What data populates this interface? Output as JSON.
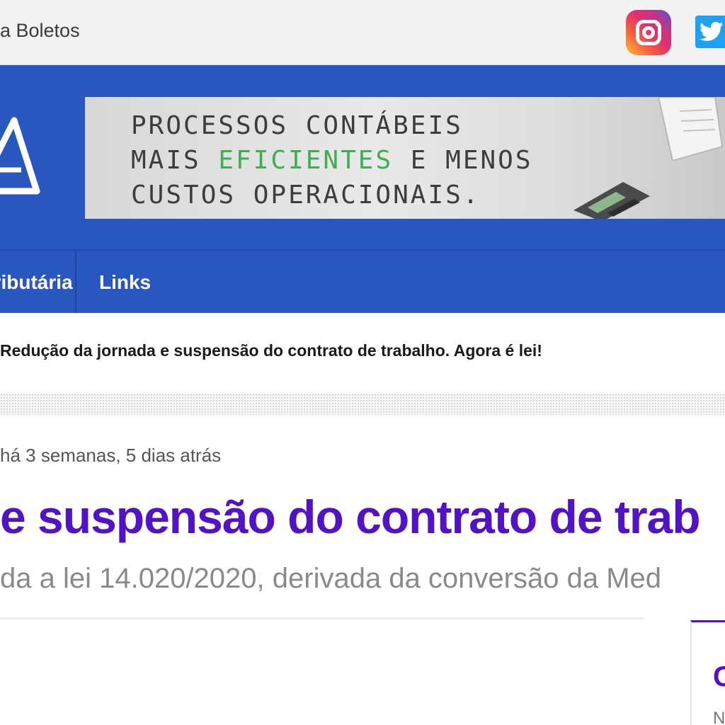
{
  "topbar": {
    "link_text": "a Boletos",
    "social": [
      "instagram-icon",
      "twitter-icon"
    ]
  },
  "banner": {
    "line1": "PROCESSOS CONTÁBEIS",
    "line2_prefix": "MAIS ",
    "line2_highlight": "EFICIENTES",
    "line2_suffix": " E MENOS",
    "line3": "CUSTOS OPERACIONAIS.",
    "highlight_color": "#3fae52"
  },
  "nav": {
    "items": [
      {
        "label": "Tributária"
      },
      {
        "label": "Links"
      }
    ]
  },
  "ticker": {
    "text": "Redução da jornada e suspensão do contrato de trabalho. Agora é lei!"
  },
  "article": {
    "meta": "há 3 semanas, 5 dias atrás",
    "title": "e suspensão do contrato de trab",
    "lead": "da a lei 14.020/2020, derivada da conversão da Med"
  },
  "sidebar": {
    "big": "C",
    "small": "N"
  },
  "colors": {
    "header_blue": "#2a56c0",
    "title_purple": "#5212c6"
  }
}
